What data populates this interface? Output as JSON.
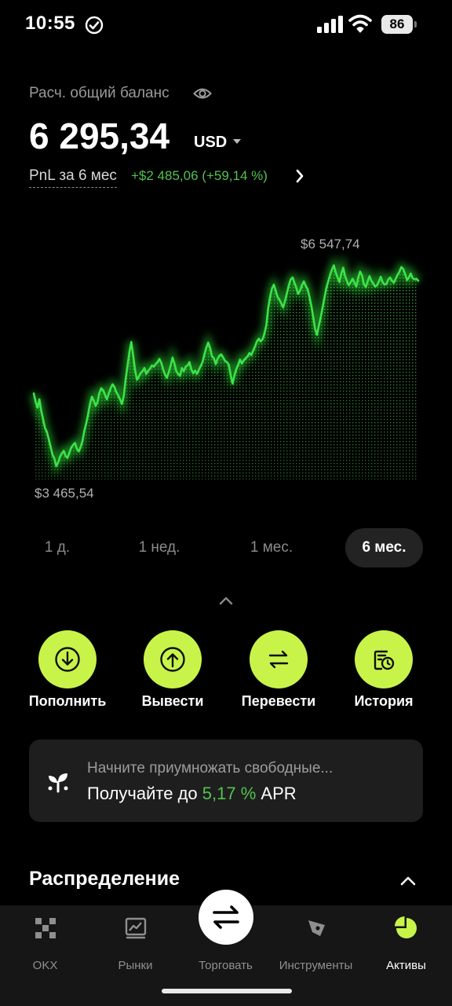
{
  "status_bar": {
    "time": "10:55",
    "battery": "86"
  },
  "balance": {
    "label": "Расч. общий баланс",
    "amount": "6 295,34",
    "currency": "USD",
    "pnl_label": "PnL за 6 мес",
    "pnl_value": "+$2 485,06 (+59,14 %)"
  },
  "chart": {
    "max_label": "$6 547,74",
    "min_label": "$3 465,54",
    "accent_color": "#3ee24a"
  },
  "chart_data": {
    "type": "area",
    "xlabel": "",
    "ylabel": "",
    "ylim": [
      3200,
      7000
    ],
    "values": [
      4580,
      4450,
      4360,
      4490,
      4310,
      4180,
      4050,
      3990,
      3880,
      3760,
      3640,
      3580,
      3465,
      3520,
      3610,
      3660,
      3700,
      3620,
      3590,
      3670,
      3750,
      3790,
      3820,
      3730,
      3690,
      3760,
      3850,
      4010,
      4120,
      4260,
      4420,
      4530,
      4470,
      4390,
      4450,
      4590,
      4660,
      4630,
      4560,
      4490,
      4580,
      4660,
      4720,
      4680,
      4600,
      4550,
      4490,
      4420,
      4540,
      4800,
      5000,
      5210,
      5370,
      5160,
      4940,
      4790,
      4840,
      4890,
      4920,
      4970,
      4880,
      4930,
      4960,
      5010,
      4990,
      5030,
      5060,
      5110,
      5050,
      4950,
      4870,
      4820,
      4910,
      5010,
      5130,
      5040,
      4920,
      4880,
      4850,
      4970,
      4920,
      4990,
      5010,
      5060,
      4950,
      4890,
      4930,
      4880,
      4940,
      5000,
      5060,
      5180,
      5280,
      5360,
      5280,
      5150,
      5120,
      5030,
      5110,
      5160,
      5180,
      5130,
      5080,
      5060,
      5020,
      4860,
      4730,
      4860,
      4950,
      5020,
      5100,
      5040,
      5090,
      5120,
      5150,
      5200,
      5170,
      5240,
      5300,
      5380,
      5420,
      5380,
      5410,
      5500,
      5630,
      5890,
      6060,
      6190,
      6250,
      6160,
      6060,
      6020,
      5960,
      5900,
      6010,
      6120,
      6240,
      6330,
      6360,
      6280,
      6200,
      6110,
      6160,
      6240,
      6300,
      6230,
      6180,
      6060,
      5920,
      5760,
      5570,
      5480,
      5620,
      5750,
      5900,
      6050,
      6200,
      6300,
      6400,
      6480,
      6547,
      6440,
      6360,
      6290,
      6420,
      6510,
      6380,
      6300,
      6240,
      6290,
      6340,
      6280,
      6220,
      6360,
      6450,
      6390,
      6260,
      6210,
      6300,
      6380,
      6310,
      6270,
      6220,
      6240,
      6300,
      6370,
      6290,
      6250,
      6260,
      6330,
      6360,
      6310,
      6280,
      6340,
      6400,
      6450,
      6520,
      6490,
      6410,
      6320,
      6360,
      6420,
      6350,
      6330,
      6340,
      6310
    ]
  },
  "periods": [
    {
      "label": "1 д."
    },
    {
      "label": "1 нед."
    },
    {
      "label": "1 мес."
    },
    {
      "label": "6 мес."
    }
  ],
  "actions": [
    {
      "label": "Пополнить",
      "icon": "deposit-icon"
    },
    {
      "label": "Вывести",
      "icon": "withdraw-icon"
    },
    {
      "label": "Перевести",
      "icon": "transfer-icon"
    },
    {
      "label": "История",
      "icon": "history-icon"
    }
  ],
  "promo": {
    "title": "Начните приумножать свободные...",
    "subtitle_prefix": "Получайте до",
    "rate": "5,17 %",
    "subtitle_suffix": "APR"
  },
  "section": {
    "title": "Распределение"
  },
  "nav": [
    {
      "label": "OKX",
      "icon": "okx-logo-icon"
    },
    {
      "label": "Рынки",
      "icon": "markets-icon"
    },
    {
      "label": "Торговать",
      "icon": "trade-icon"
    },
    {
      "label": "Инструменты",
      "icon": "tools-icon"
    },
    {
      "label": "Активы",
      "icon": "assets-icon"
    }
  ],
  "colors": {
    "accent_lime": "#c8f44a",
    "positive_green": "#53c24e",
    "background": "#000000",
    "card": "#1e1e1e"
  }
}
